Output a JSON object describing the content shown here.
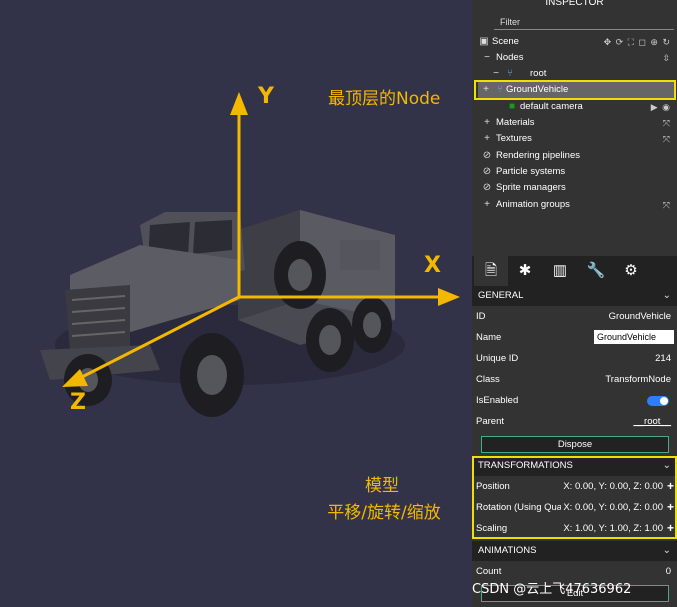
{
  "viewport": {
    "axes": {
      "y": "Y",
      "x": "X",
      "z": "Z"
    },
    "annotation_top": "最顶层的Node",
    "annotation_bottom_line1": "模型",
    "annotation_bottom_line2": "平移/旋转/缩放",
    "accent_color": "#f5b800",
    "highlight_color": "#f0e000"
  },
  "inspector": {
    "title": "INSPECTOR",
    "filter_label": "Filter",
    "tree": {
      "scene": "Scene",
      "nodes": "Nodes",
      "root": "root",
      "ground_vehicle": "GroundVehicle",
      "default_camera": "default camera",
      "materials": "Materials",
      "textures": "Textures",
      "rendering_pipelines": "Rendering pipelines",
      "particle_systems": "Particle systems",
      "sprite_managers": "Sprite managers",
      "animation_groups": "Animation groups"
    },
    "tabs": [
      "general-tab",
      "debug-tab",
      "statistics-tab",
      "tools-tab",
      "settings-tab"
    ],
    "general": {
      "header": "GENERAL",
      "id_label": "ID",
      "id_value": "GroundVehicle",
      "name_label": "Name",
      "name_value": "GroundVehicle",
      "unique_id_label": "Unique ID",
      "unique_id_value": "214",
      "class_label": "Class",
      "class_value": "TransformNode",
      "is_enabled_label": "IsEnabled",
      "is_enabled_value": true,
      "parent_label": "Parent",
      "parent_value": "__root__",
      "dispose_label": "Dispose"
    },
    "transformations": {
      "header": "TRANSFORMATIONS",
      "position_label": "Position",
      "position_value": "X: 0.00, Y: 0.00, Z: 0.00",
      "rotation_label": "Rotation (Using Qua",
      "rotation_value": "X: 0.00, Y: 0.00, Z: 0.00",
      "scaling_label": "Scaling",
      "scaling_value": "X: 1.00, Y: 1.00, Z: 1.00"
    },
    "animations": {
      "header": "ANIMATIONS",
      "count_label": "Count",
      "count_value": "0",
      "edit_label": "Edit"
    }
  },
  "watermark": "CSDN @云上飞47636962"
}
